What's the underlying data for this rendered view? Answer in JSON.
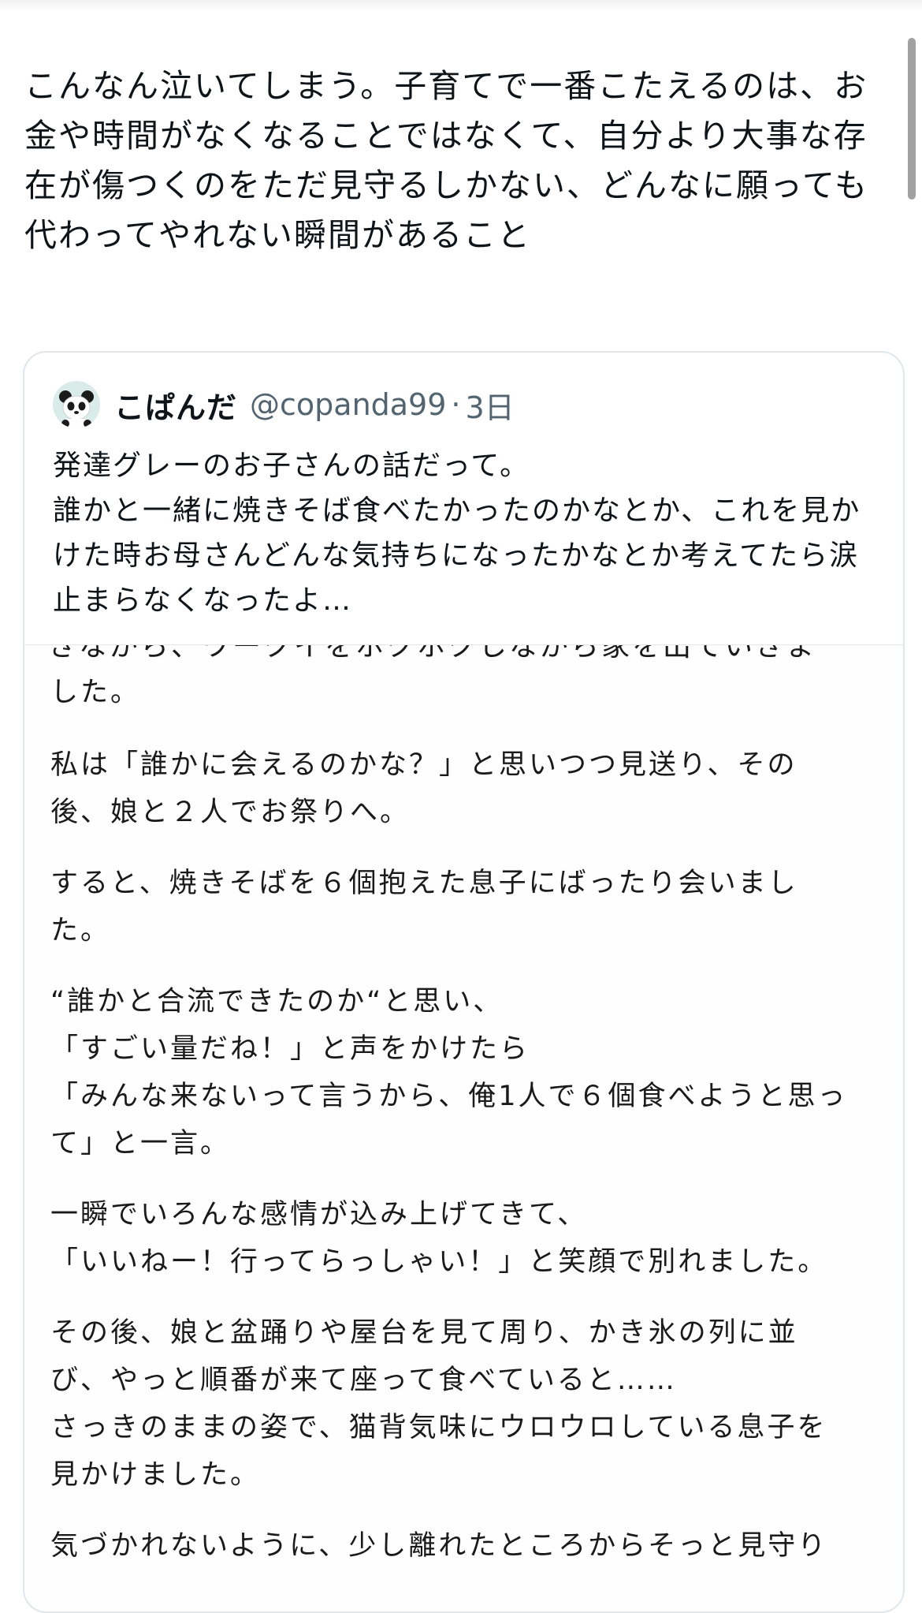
{
  "tweet": {
    "text": "こんなん泣いてしまう。子育てで一番こたえるのは、お金や時間がなくなることではなくて、自分より大事な存在が傷つくのをただ見守るしかない、どんなに願っても代わってやれない瞬間があること"
  },
  "quote": {
    "avatar_icon": "panda-avatar-icon",
    "display_name": "こぱんだ",
    "handle": "@copanda99",
    "separator": "·",
    "time": "3日",
    "text": "発達グレーのお子さんの話だって。\n誰かと一緒に焼きそば食べたかったのかなとか、これを見かけた時お母さんどんな気持ちになったかなとか考えてたら涙止まらなくなったよ…"
  },
  "media": {
    "cut_line": "きながら、ワークイをホクホクしながら家を出ていきま",
    "paragraphs": [
      "した。",
      "私は「誰かに会えるのかな？」と思いつつ見送り、その\n後、娘と２人でお祭りへ。",
      "すると、焼きそばを６個抱えた息子にばったり会いまし\nた。",
      "“誰かと合流できたのか“と思い、\n「すごい量だね！」と声をかけたら\n「みんな来ないって言うから、俺1人で６個食べようと思っ\nて」と一言。",
      "一瞬でいろんな感情が込み上げてきて、\n「いいねー！行ってらっしゃい！」と笑顔で別れました。",
      "その後、娘と盆踊りや屋台を見て周り、かき氷の列に並\nび、やっと順番が来て座って食べていると……\nさっきのままの姿で、猫背気味にウロウロしている息子を\n見かけました。",
      "気づかれないように、少し離れたところからそっと見守り"
    ]
  }
}
